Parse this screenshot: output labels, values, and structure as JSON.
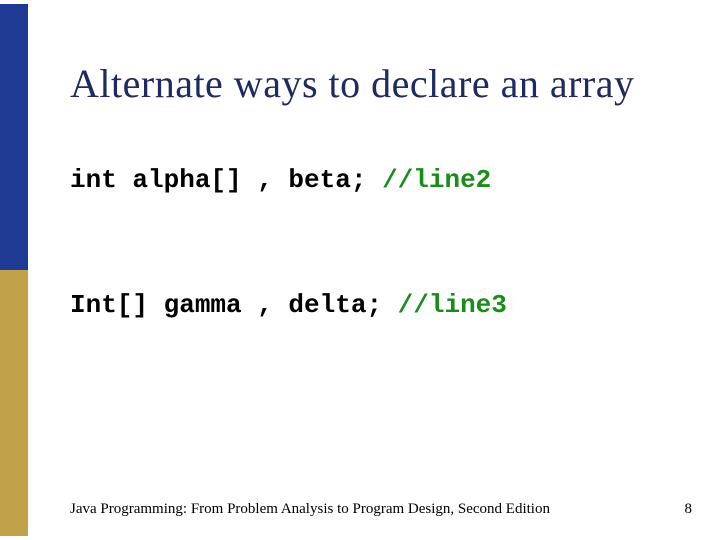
{
  "title": "Alternate ways to declare an array",
  "code": {
    "line2": {
      "part1": "int alpha[] , beta; ",
      "comment": "//line2"
    },
    "line3": {
      "part1": "Int[] gamma , delta; ",
      "comment": "//line3"
    }
  },
  "footer_text": "Java Programming: From Problem Analysis to Program Design, Second Edition",
  "page_number": "8",
  "colors": {
    "stripe_blue": "#1f3a93",
    "stripe_gold": "#c0a24a",
    "title_color": "#1f2a60",
    "comment_color": "#1a8c1a"
  }
}
